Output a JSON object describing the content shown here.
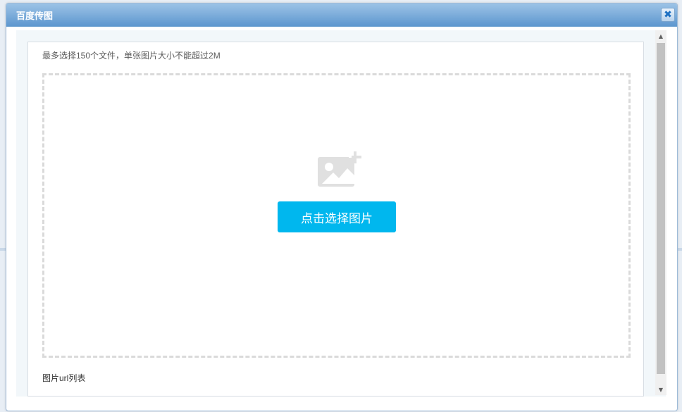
{
  "dialog": {
    "title": "百度传图",
    "close_glyph": "✖"
  },
  "upload": {
    "hint": "最多选择150个文件，单张图片大小不能超过2M",
    "pick_button": "点击选择图片",
    "url_list_label": "图片url列表"
  },
  "icons": {
    "image_add": "image-add-icon",
    "close": "close-icon"
  },
  "colors": {
    "titlebar": "#5e97cf",
    "pick_button": "#00b7ee"
  }
}
